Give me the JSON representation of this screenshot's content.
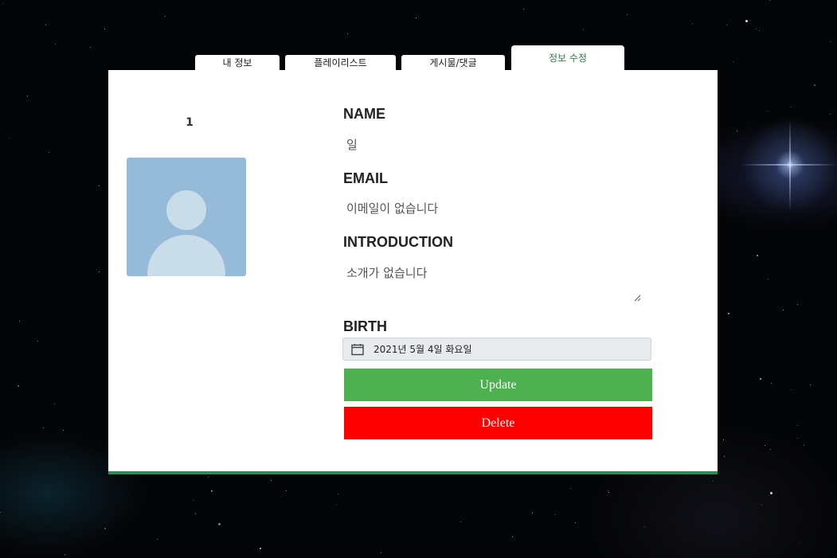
{
  "tabs": [
    {
      "label": "내 정보"
    },
    {
      "label": "플레이리스트"
    },
    {
      "label": "게시물/댓글"
    },
    {
      "label": "정보 수정",
      "active": true
    }
  ],
  "profile": {
    "user_number": "1",
    "avatar_icon": "default-user-icon"
  },
  "form": {
    "name_label": "NAME",
    "name_value": "일",
    "email_label": "EMAIL",
    "email_value": "이메일이 없습니다",
    "intro_label": "INTRODUCTION",
    "intro_value": "소개가 없습니다",
    "birth_label": "BIRTH",
    "birth_value": "2021년 5월 4일 화요일",
    "calendar_icon": "calendar-icon"
  },
  "actions": {
    "update_label": "Update",
    "delete_label": "Delete"
  },
  "colors": {
    "accent": "#2e8b57",
    "update": "#4caf50",
    "delete": "#ff0000"
  }
}
